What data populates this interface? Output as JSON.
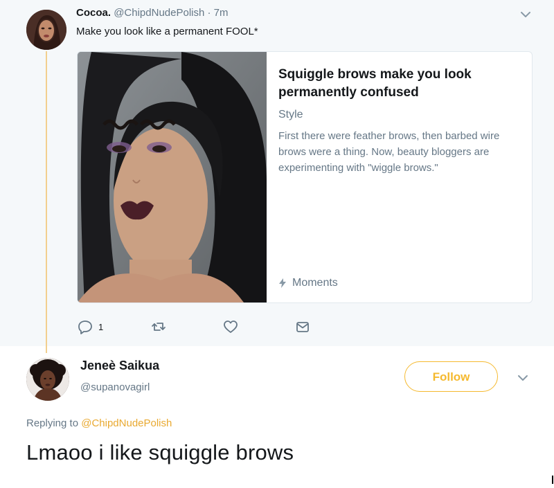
{
  "parent_tweet": {
    "name": "Cocoa.",
    "handle": "@ChipdNudePolish",
    "time": "· 7m",
    "text": "Make you look like a permanent FOOL*",
    "card": {
      "title": "Squiggle brows make you look permanently confused",
      "domain": "Style",
      "description": "First there were feather brows, then barbed wire brows were a thing. Now, beauty bloggers are experimenting with \"wiggle brows.\"",
      "source": "Moments"
    },
    "actions": {
      "reply_count": "1",
      "reply_icon": "reply-icon",
      "retweet_icon": "retweet-icon",
      "like_icon": "heart-icon",
      "dm_icon": "envelope-icon"
    }
  },
  "reply_tweet": {
    "name": "Jeneè Saikua",
    "handle": "@supanovagirl",
    "follow_label": "Follow",
    "replying_prefix": "Replying to ",
    "replying_to": "@ChipdNudePolish",
    "text": "Lmaoo i like squiggle brows"
  },
  "colors": {
    "accent": "#f5b92e",
    "mention": "#e9a930",
    "thread_line": "#f2cf8e",
    "muted_text": "#657786",
    "parent_background": "#f5f8fa"
  }
}
